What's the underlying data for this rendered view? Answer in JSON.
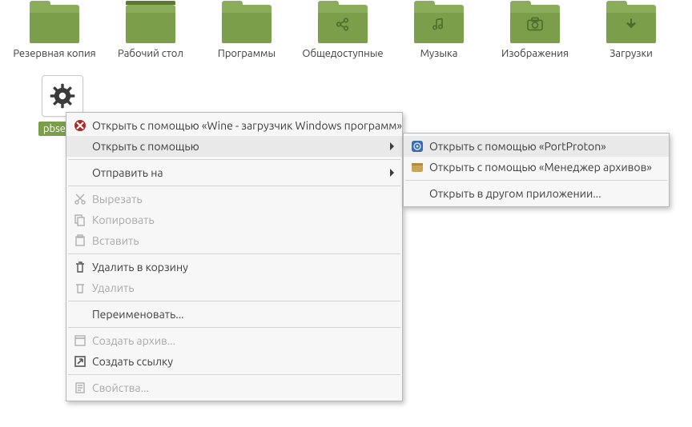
{
  "folders": [
    {
      "label": "Резервная копия",
      "sym": ""
    },
    {
      "label": "Рабочий стол",
      "sym": "",
      "desktop": true
    },
    {
      "label": "Программы",
      "sym": ""
    },
    {
      "label": "Общедоступные",
      "sym": "share"
    },
    {
      "label": "Музыка",
      "sym": "music"
    },
    {
      "label": "Изображения",
      "sym": "image"
    },
    {
      "label": "Загрузки",
      "sym": "download"
    }
  ],
  "exe": {
    "label": "pbsetup"
  },
  "main_menu": [
    {
      "icon": "wine-icon",
      "label": "Открыть с помощью «Wine - загрузчик Windows программ»"
    },
    {
      "icon": "",
      "label": "Открыть с помощью",
      "submenu": true,
      "hover": true
    },
    {
      "sep": true
    },
    {
      "icon": "",
      "label": "Отправить на",
      "submenu": true
    },
    {
      "sep": true
    },
    {
      "icon": "cut-icon",
      "label": "Вырезать",
      "disabled": true
    },
    {
      "icon": "copy-icon",
      "label": "Копировать",
      "disabled": true
    },
    {
      "icon": "paste-icon",
      "label": "Вставить",
      "disabled": true
    },
    {
      "sep": true
    },
    {
      "icon": "trash-icon",
      "label": "Удалить в корзину"
    },
    {
      "icon": "delete-icon",
      "label": "Удалить",
      "disabled": true
    },
    {
      "sep": true
    },
    {
      "icon": "",
      "label": "Переименовать..."
    },
    {
      "sep": true
    },
    {
      "icon": "archive-icon",
      "label": "Создать архив...",
      "disabled": true
    },
    {
      "icon": "link-icon",
      "label": "Создать ссылку"
    },
    {
      "sep": true
    },
    {
      "icon": "props-icon",
      "label": "Свойства...",
      "disabled": true
    }
  ],
  "sub_menu": [
    {
      "icon": "portproton-icon",
      "label": "Открыть с помощью «PortProton»",
      "hover": true
    },
    {
      "icon": "archive-mgr-icon",
      "label": "Открыть с помощью «Менеджер архивов»"
    },
    {
      "sep": true
    },
    {
      "icon": "",
      "label": "Открыть в другом приложении..."
    }
  ]
}
